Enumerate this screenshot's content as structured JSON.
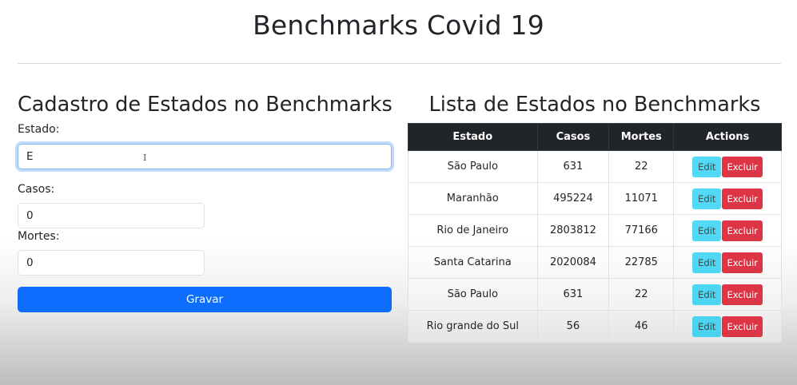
{
  "header": {
    "title": "Benchmarks Covid 19"
  },
  "form": {
    "heading": "Cadastro de Estados no Benchmarks",
    "estado_label": "Estado:",
    "estado_value": "E",
    "casos_label": "Casos:",
    "casos_value": "0",
    "mortes_label": "Mortes:",
    "mortes_value": "0",
    "submit_label": "Gravar"
  },
  "list": {
    "heading": "Lista de Estados no Benchmarks",
    "columns": [
      "Estado",
      "Casos",
      "Mortes",
      "Actions"
    ],
    "rows": [
      {
        "estado": "São Paulo",
        "casos": "631",
        "mortes": "22",
        "edit": "Edit",
        "delete": "Excluir"
      },
      {
        "estado": "Maranhão",
        "casos": "495224",
        "mortes": "11071",
        "edit": "Edit",
        "delete": "Excluir"
      },
      {
        "estado": "Rio de Janeiro",
        "casos": "2803812",
        "mortes": "77166",
        "edit": "Edit",
        "delete": "Excluir"
      },
      {
        "estado": "Santa Catarina",
        "casos": "2020084",
        "mortes": "22785",
        "edit": "Edit",
        "delete": "Excluir"
      },
      {
        "estado": "São Paulo",
        "casos": "631",
        "mortes": "22",
        "edit": "Edit",
        "delete": "Excluir"
      },
      {
        "estado": "Rio grande do Sul",
        "casos": "56",
        "mortes": "46",
        "edit": "Edit",
        "delete": "Excluir"
      }
    ]
  },
  "colors": {
    "primary": "#0d6efd",
    "info": "#0dcaf0",
    "danger": "#dc3545",
    "table_header": "#212529"
  }
}
